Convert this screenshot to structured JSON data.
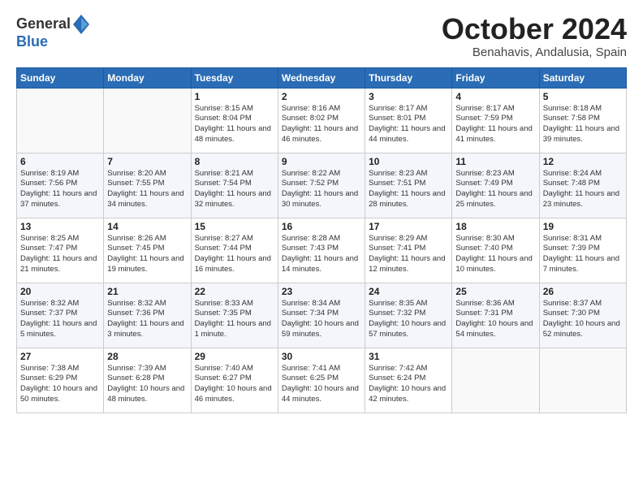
{
  "logo": {
    "general": "General",
    "blue": "Blue"
  },
  "header": {
    "month": "October 2024",
    "location": "Benahavis, Andalusia, Spain"
  },
  "weekdays": [
    "Sunday",
    "Monday",
    "Tuesday",
    "Wednesday",
    "Thursday",
    "Friday",
    "Saturday"
  ],
  "weeks": [
    [
      {
        "day": "",
        "sunrise": "",
        "sunset": "",
        "daylight": ""
      },
      {
        "day": "",
        "sunrise": "",
        "sunset": "",
        "daylight": ""
      },
      {
        "day": "1",
        "sunrise": "Sunrise: 8:15 AM",
        "sunset": "Sunset: 8:04 PM",
        "daylight": "Daylight: 11 hours and 48 minutes."
      },
      {
        "day": "2",
        "sunrise": "Sunrise: 8:16 AM",
        "sunset": "Sunset: 8:02 PM",
        "daylight": "Daylight: 11 hours and 46 minutes."
      },
      {
        "day": "3",
        "sunrise": "Sunrise: 8:17 AM",
        "sunset": "Sunset: 8:01 PM",
        "daylight": "Daylight: 11 hours and 44 minutes."
      },
      {
        "day": "4",
        "sunrise": "Sunrise: 8:17 AM",
        "sunset": "Sunset: 7:59 PM",
        "daylight": "Daylight: 11 hours and 41 minutes."
      },
      {
        "day": "5",
        "sunrise": "Sunrise: 8:18 AM",
        "sunset": "Sunset: 7:58 PM",
        "daylight": "Daylight: 11 hours and 39 minutes."
      }
    ],
    [
      {
        "day": "6",
        "sunrise": "Sunrise: 8:19 AM",
        "sunset": "Sunset: 7:56 PM",
        "daylight": "Daylight: 11 hours and 37 minutes."
      },
      {
        "day": "7",
        "sunrise": "Sunrise: 8:20 AM",
        "sunset": "Sunset: 7:55 PM",
        "daylight": "Daylight: 11 hours and 34 minutes."
      },
      {
        "day": "8",
        "sunrise": "Sunrise: 8:21 AM",
        "sunset": "Sunset: 7:54 PM",
        "daylight": "Daylight: 11 hours and 32 minutes."
      },
      {
        "day": "9",
        "sunrise": "Sunrise: 8:22 AM",
        "sunset": "Sunset: 7:52 PM",
        "daylight": "Daylight: 11 hours and 30 minutes."
      },
      {
        "day": "10",
        "sunrise": "Sunrise: 8:23 AM",
        "sunset": "Sunset: 7:51 PM",
        "daylight": "Daylight: 11 hours and 28 minutes."
      },
      {
        "day": "11",
        "sunrise": "Sunrise: 8:23 AM",
        "sunset": "Sunset: 7:49 PM",
        "daylight": "Daylight: 11 hours and 25 minutes."
      },
      {
        "day": "12",
        "sunrise": "Sunrise: 8:24 AM",
        "sunset": "Sunset: 7:48 PM",
        "daylight": "Daylight: 11 hours and 23 minutes."
      }
    ],
    [
      {
        "day": "13",
        "sunrise": "Sunrise: 8:25 AM",
        "sunset": "Sunset: 7:47 PM",
        "daylight": "Daylight: 11 hours and 21 minutes."
      },
      {
        "day": "14",
        "sunrise": "Sunrise: 8:26 AM",
        "sunset": "Sunset: 7:45 PM",
        "daylight": "Daylight: 11 hours and 19 minutes."
      },
      {
        "day": "15",
        "sunrise": "Sunrise: 8:27 AM",
        "sunset": "Sunset: 7:44 PM",
        "daylight": "Daylight: 11 hours and 16 minutes."
      },
      {
        "day": "16",
        "sunrise": "Sunrise: 8:28 AM",
        "sunset": "Sunset: 7:43 PM",
        "daylight": "Daylight: 11 hours and 14 minutes."
      },
      {
        "day": "17",
        "sunrise": "Sunrise: 8:29 AM",
        "sunset": "Sunset: 7:41 PM",
        "daylight": "Daylight: 11 hours and 12 minutes."
      },
      {
        "day": "18",
        "sunrise": "Sunrise: 8:30 AM",
        "sunset": "Sunset: 7:40 PM",
        "daylight": "Daylight: 11 hours and 10 minutes."
      },
      {
        "day": "19",
        "sunrise": "Sunrise: 8:31 AM",
        "sunset": "Sunset: 7:39 PM",
        "daylight": "Daylight: 11 hours and 7 minutes."
      }
    ],
    [
      {
        "day": "20",
        "sunrise": "Sunrise: 8:32 AM",
        "sunset": "Sunset: 7:37 PM",
        "daylight": "Daylight: 11 hours and 5 minutes."
      },
      {
        "day": "21",
        "sunrise": "Sunrise: 8:32 AM",
        "sunset": "Sunset: 7:36 PM",
        "daylight": "Daylight: 11 hours and 3 minutes."
      },
      {
        "day": "22",
        "sunrise": "Sunrise: 8:33 AM",
        "sunset": "Sunset: 7:35 PM",
        "daylight": "Daylight: 11 hours and 1 minute."
      },
      {
        "day": "23",
        "sunrise": "Sunrise: 8:34 AM",
        "sunset": "Sunset: 7:34 PM",
        "daylight": "Daylight: 10 hours and 59 minutes."
      },
      {
        "day": "24",
        "sunrise": "Sunrise: 8:35 AM",
        "sunset": "Sunset: 7:32 PM",
        "daylight": "Daylight: 10 hours and 57 minutes."
      },
      {
        "day": "25",
        "sunrise": "Sunrise: 8:36 AM",
        "sunset": "Sunset: 7:31 PM",
        "daylight": "Daylight: 10 hours and 54 minutes."
      },
      {
        "day": "26",
        "sunrise": "Sunrise: 8:37 AM",
        "sunset": "Sunset: 7:30 PM",
        "daylight": "Daylight: 10 hours and 52 minutes."
      }
    ],
    [
      {
        "day": "27",
        "sunrise": "Sunrise: 7:38 AM",
        "sunset": "Sunset: 6:29 PM",
        "daylight": "Daylight: 10 hours and 50 minutes."
      },
      {
        "day": "28",
        "sunrise": "Sunrise: 7:39 AM",
        "sunset": "Sunset: 6:28 PM",
        "daylight": "Daylight: 10 hours and 48 minutes."
      },
      {
        "day": "29",
        "sunrise": "Sunrise: 7:40 AM",
        "sunset": "Sunset: 6:27 PM",
        "daylight": "Daylight: 10 hours and 46 minutes."
      },
      {
        "day": "30",
        "sunrise": "Sunrise: 7:41 AM",
        "sunset": "Sunset: 6:25 PM",
        "daylight": "Daylight: 10 hours and 44 minutes."
      },
      {
        "day": "31",
        "sunrise": "Sunrise: 7:42 AM",
        "sunset": "Sunset: 6:24 PM",
        "daylight": "Daylight: 10 hours and 42 minutes."
      },
      {
        "day": "",
        "sunrise": "",
        "sunset": "",
        "daylight": ""
      },
      {
        "day": "",
        "sunrise": "",
        "sunset": "",
        "daylight": ""
      }
    ]
  ]
}
